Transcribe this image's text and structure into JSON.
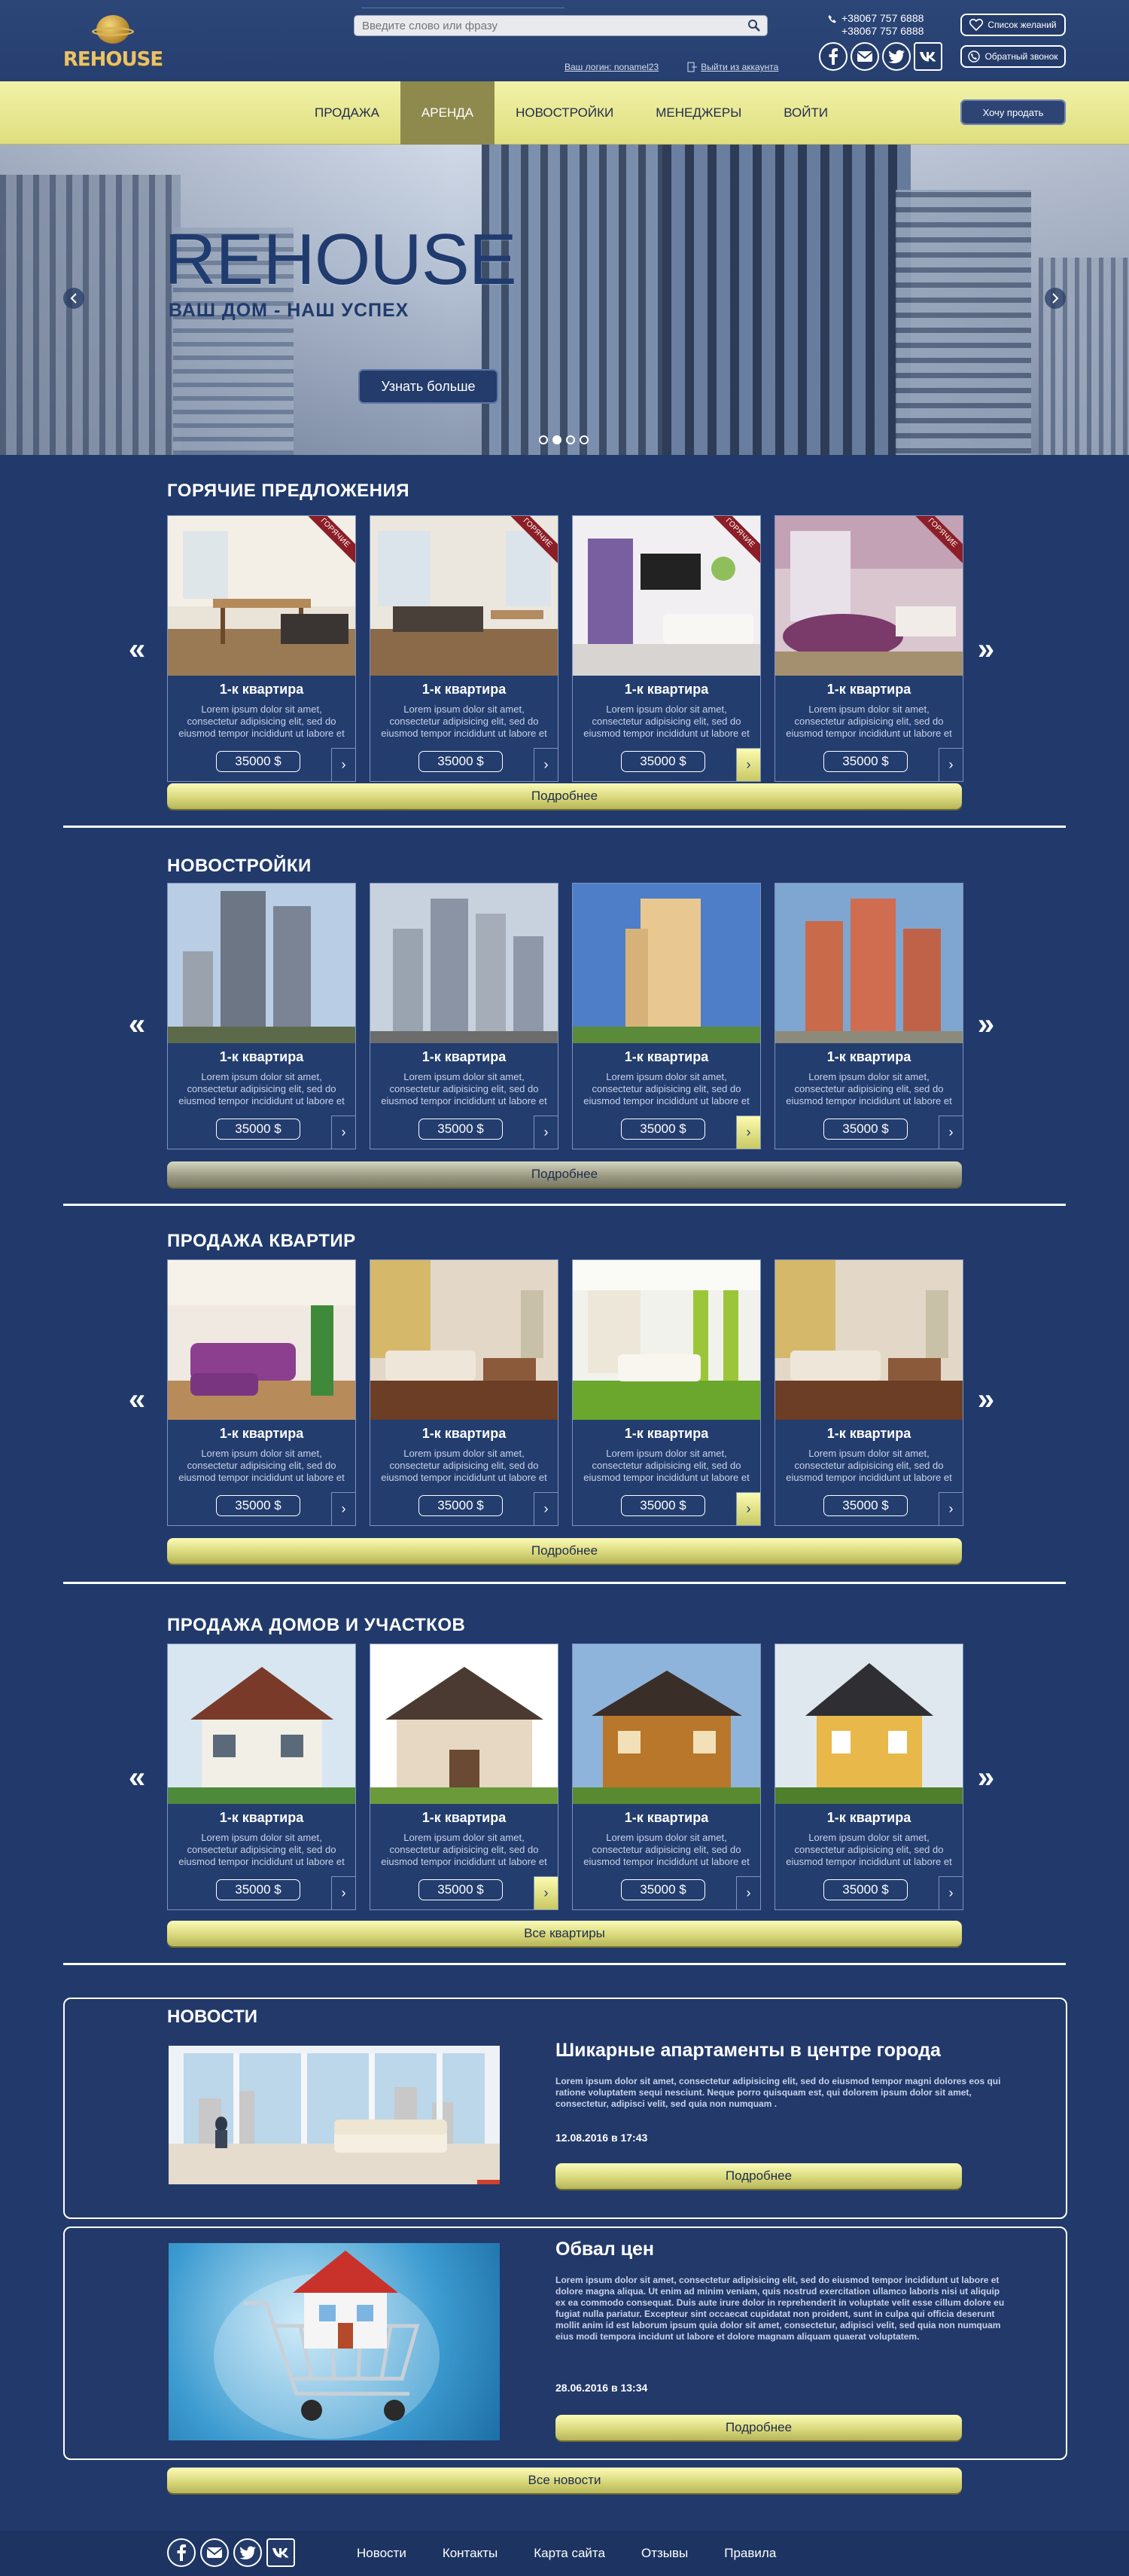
{
  "header": {
    "logo_text": "REHOUSE",
    "search_placeholder": "Введите слово или фразу",
    "account_login": "Ваш логин: nonamel23",
    "account_logout": "Выйти из аккаунта",
    "phones": [
      "+38067 757 6888",
      "+38067 757 6888"
    ],
    "wishlist_label": "Список желаний",
    "callback_label": "Обратный звонок"
  },
  "nav": {
    "items": [
      "ПРОДАЖА",
      "АРЕНДА",
      "НОВОСТРОЙКИ",
      "МЕНЕДЖЕРЫ",
      "ВОЙТИ"
    ],
    "active": "АРЕНДА",
    "cta_label": "Хочу продать"
  },
  "hero": {
    "title": "REHOUSE",
    "subtitle": "ВАШ ДОМ - НАШ УСПЕХ",
    "button_label": "Узнать больше",
    "slides": 4,
    "active_slide": 2
  },
  "sections": [
    {
      "title": "ГОРЯЧИЕ ПРЕДЛОЖЕНИЯ",
      "button_label": "Подробнее",
      "cards": [
        {
          "title": "1-к квартира",
          "desc": "Lorem ipsum dolor sit amet, consectetur adipisicing elit, sed do eiusmod tempor incididunt ut labore et",
          "price": "35000 $",
          "badge": "ГОРЯЧИЕ",
          "image": "interior-dining"
        },
        {
          "title": "1-к квартира",
          "desc": "Lorem ipsum dolor sit amet, consectetur adipisicing elit, sed do eiusmod tempor incididunt ut labore et",
          "price": "35000 $",
          "badge": "ГОРЯЧИЕ",
          "image": "interior-living"
        },
        {
          "title": "1-к квартира",
          "desc": "Lorem ipsum dolor sit amet, consectetur adipisicing elit, sed do eiusmod tempor incididunt ut labore et",
          "price": "35000 $",
          "badge": "ГОРЯЧИЕ",
          "image": "interior-white"
        },
        {
          "title": "1-к квартира",
          "desc": "Lorem ipsum dolor sit amet, consectetur adipisicing elit, sed do eiusmod tempor incididunt ut labore et",
          "price": "35000 $",
          "badge": "ГОРЯЧИЕ",
          "image": "interior-bedroom"
        }
      ]
    },
    {
      "title": "НОВОСТРОЙКИ",
      "button_label": "Подробнее",
      "cards": [
        {
          "title": "1-к квартира",
          "desc": "Lorem ipsum dolor sit amet, consectetur adipisicing elit, sed do eiusmod tempor incididunt ut labore et",
          "price": "35000 $",
          "image": "tower-grey"
        },
        {
          "title": "1-к квартира",
          "desc": "Lorem ipsum dolor sit amet, consectetur adipisicing elit, sed do eiusmod tempor incididunt ut labore et",
          "price": "35000 $",
          "image": "tower-cluster"
        },
        {
          "title": "1-к квартира",
          "desc": "Lorem ipsum dolor sit amet, consectetur adipisicing elit, sed do eiusmod tempor incididunt ut labore et",
          "price": "35000 $",
          "image": "tower-beige"
        },
        {
          "title": "1-к квартира",
          "desc": "Lorem ipsum dolor sit amet, consectetur adipisicing elit, sed do eiusmod tempor incididunt ut labore et",
          "price": "35000 $",
          "image": "tower-red"
        }
      ]
    },
    {
      "title": "ПРОДАЖА КВАРТИР",
      "button_label": "Подробнее",
      "cards": [
        {
          "title": "1-к квартира",
          "desc": "Lorem ipsum dolor sit amet, consectetur adipisicing elit, sed do eiusmod tempor incididunt ut labore et",
          "price": "35000 $",
          "image": "interior-purple"
        },
        {
          "title": "1-к квартира",
          "desc": "Lorem ipsum dolor sit amet, consectetur adipisicing elit, sed do eiusmod tempor incididunt ut labore et",
          "price": "35000 $",
          "image": "interior-brown"
        },
        {
          "title": "1-к квартира",
          "desc": "Lorem ipsum dolor sit amet, consectetur adipisicing elit, sed do eiusmod tempor incididunt ut labore et",
          "price": "35000 $",
          "image": "interior-green"
        },
        {
          "title": "1-к квартира",
          "desc": "Lorem ipsum dolor sit amet, consectetur adipisicing elit, sed do eiusmod tempor incididunt ut labore et",
          "price": "35000 $",
          "image": "interior-brown"
        }
      ]
    },
    {
      "title": "ПРОДАЖА ДОМОВ И УЧАСТКОВ",
      "button_label": "Все квартиры",
      "cards": [
        {
          "title": "1-к квартира",
          "desc": "Lorem ipsum dolor sit amet, consectetur adipisicing elit, sed do eiusmod tempor incididunt ut labore et",
          "price": "35000 $",
          "image": "house-white"
        },
        {
          "title": "1-к квартира",
          "desc": "Lorem ipsum dolor sit amet, consectetur adipisicing elit, sed do eiusmod tempor incididunt ut labore et",
          "price": "35000 $",
          "image": "house-brown"
        },
        {
          "title": "1-к квартира",
          "desc": "Lorem ipsum dolor sit amet, consectetur adipisicing elit, sed do eiusmod tempor incididunt ut labore et",
          "price": "35000 $",
          "image": "house-wood"
        },
        {
          "title": "1-к квартира",
          "desc": "Lorem ipsum dolor sit amet, consectetur adipisicing elit, sed do eiusmod tempor incididunt ut labore et",
          "price": "35000 $",
          "image": "house-yellow"
        }
      ]
    }
  ],
  "news": {
    "title": "НОВОСТИ",
    "items": [
      {
        "headline": "Шикарные апартаменты в центре города",
        "text": "Lorem ipsum dolor sit amet, consectetur adipisicing elit, sed do eiusmod tempor magni dolores eos qui ratione voluptatem sequi nesciunt. Neque porro quisquam est, qui dolorem ipsum dolor sit amet, consectetur, adipisci velit, sed quia non numquam .",
        "date": "12.08.2016 в 17:43",
        "button_label": "Подробнее"
      },
      {
        "headline": "Обвал цен",
        "text": "Lorem ipsum dolor sit amet, consectetur adipisicing elit, sed do eiusmod tempor incididunt ut labore et dolore magna aliqua. Ut enim ad minim veniam, quis nostrud exercitation ullamco laboris nisi ut aliquip ex ea commodo consequat. Duis aute irure dolor in reprehenderit in voluptate velit esse cillum dolore eu fugiat nulla pariatur. Excepteur sint occaecat cupidatat non proident, sunt in culpa qui officia deserunt mollit anim id est laborum ipsum quia dolor sit amet, consectetur, adipisci velit, sed quia non numquam eius modi tempora incidunt ut labore et dolore magnam aliquam quaerat voluptatem.",
        "date": "28.06.2016 в 13:34",
        "button_label": "Подробнее"
      }
    ],
    "all_label": "Все новости"
  },
  "footer": {
    "links": [
      "Новости",
      "Контакты",
      "Карта сайта",
      "Отзывы",
      "Правила"
    ]
  },
  "colors": {
    "page_bg": "#213a6b",
    "nav_bg": "#e8e894",
    "nav_active": "#8e8a4e",
    "button_gold": "#d9d97c",
    "hot_badge": "#8b1e26"
  }
}
